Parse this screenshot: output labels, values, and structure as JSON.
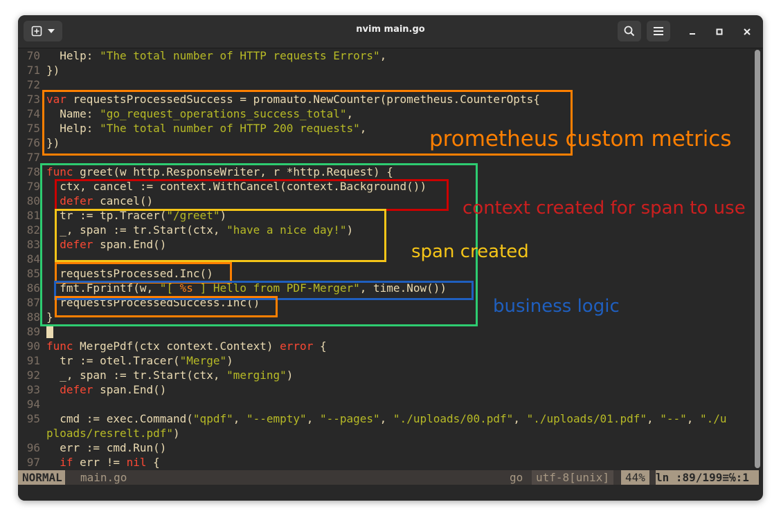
{
  "window": {
    "title": "nvim main.go"
  },
  "titlebar": {
    "new_tab_icon": "new-tab-icon",
    "dropdown_icon": "chevron-down-icon",
    "search_icon": "search-icon",
    "menu_icon": "hamburger-menu-icon",
    "minimize_icon": "minimize-icon",
    "maximize_icon": "maximize-icon",
    "close_icon": "close-icon"
  },
  "code": {
    "lines": [
      {
        "n": "70",
        "segs": [
          [
            "  Help: ",
            ""
          ],
          [
            "\"The total number of HTTP requests Errors\"",
            "str"
          ],
          [
            ",",
            ""
          ]
        ]
      },
      {
        "n": "71",
        "segs": [
          [
            "})",
            ""
          ]
        ]
      },
      {
        "n": "72",
        "segs": []
      },
      {
        "n": "73",
        "segs": [
          [
            "var",
            "kw"
          ],
          [
            " requestsProcessedSuccess = promauto.NewCounter(prometheus.CounterOpts{",
            ""
          ]
        ]
      },
      {
        "n": "74",
        "segs": [
          [
            "  Name: ",
            ""
          ],
          [
            "\"go_request_operations_success_total\"",
            "str"
          ],
          [
            ",",
            ""
          ]
        ]
      },
      {
        "n": "75",
        "segs": [
          [
            "  Help: ",
            ""
          ],
          [
            "\"The total number of HTTP 200 requests\"",
            "str"
          ],
          [
            ",",
            ""
          ]
        ]
      },
      {
        "n": "76",
        "segs": [
          [
            "})",
            ""
          ]
        ]
      },
      {
        "n": "77",
        "segs": []
      },
      {
        "n": "78",
        "segs": [
          [
            "func",
            "kw"
          ],
          [
            " greet(w http.ResponseWriter, r *http.Request) {",
            ""
          ]
        ]
      },
      {
        "n": "79",
        "segs": [
          [
            "  ctx, cancel := context.WithCancel(context.Background())",
            ""
          ]
        ]
      },
      {
        "n": "80",
        "segs": [
          [
            "  ",
            ""
          ],
          [
            "defer",
            "kw"
          ],
          [
            " cancel()",
            ""
          ]
        ]
      },
      {
        "n": "81",
        "segs": [
          [
            "  tr := tp.Tracer(",
            ""
          ],
          [
            "\"/greet\"",
            "str"
          ],
          [
            ")",
            ""
          ]
        ]
      },
      {
        "n": "82",
        "segs": [
          [
            "  _, span := tr.Start(ctx, ",
            ""
          ],
          [
            "\"have a nice day!\"",
            "str"
          ],
          [
            ")",
            ""
          ]
        ]
      },
      {
        "n": "83",
        "segs": [
          [
            "  ",
            ""
          ],
          [
            "defer",
            "kw"
          ],
          [
            " span.End()",
            ""
          ]
        ]
      },
      {
        "n": "84",
        "segs": []
      },
      {
        "n": "85",
        "segs": [
          [
            "  requestsProcessed.Inc()",
            ""
          ]
        ]
      },
      {
        "n": "86",
        "segs": [
          [
            "  fmt.Fprintf(w, ",
            ""
          ],
          [
            "\"[ ",
            "str"
          ],
          [
            "%s",
            "fmt"
          ],
          [
            " ] Hello from PDF-Merger\"",
            "str"
          ],
          [
            ", time.Now())",
            ""
          ]
        ]
      },
      {
        "n": "87",
        "segs": [
          [
            "  requestsProcessedSuccess.Inc()",
            ""
          ]
        ]
      },
      {
        "n": "88",
        "segs": [
          [
            "}",
            ""
          ]
        ]
      },
      {
        "n": "89",
        "segs": [],
        "cursor": true
      },
      {
        "n": "90",
        "segs": [
          [
            "func",
            "kw"
          ],
          [
            " MergePdf(ctx context.Context) ",
            ""
          ],
          [
            "error",
            "kw"
          ],
          [
            " {",
            ""
          ]
        ]
      },
      {
        "n": "91",
        "segs": [
          [
            "  tr := otel.Tracer(",
            ""
          ],
          [
            "\"Merge\"",
            "str"
          ],
          [
            ")",
            ""
          ]
        ]
      },
      {
        "n": "92",
        "segs": [
          [
            "  _, span := tr.Start(ctx, ",
            ""
          ],
          [
            "\"merging\"",
            "str"
          ],
          [
            ")",
            ""
          ]
        ]
      },
      {
        "n": "93",
        "segs": [
          [
            "  ",
            ""
          ],
          [
            "defer",
            "kw"
          ],
          [
            " span.End()",
            ""
          ]
        ]
      },
      {
        "n": "94",
        "segs": []
      },
      {
        "n": "95",
        "segs": [
          [
            "  cmd := exec.Command(",
            ""
          ],
          [
            "\"qpdf\"",
            "str"
          ],
          [
            ", ",
            ""
          ],
          [
            "\"--empty\"",
            "str"
          ],
          [
            ", ",
            ""
          ],
          [
            "\"--pages\"",
            "str"
          ],
          [
            ", ",
            ""
          ],
          [
            "\"./uploads/00.pdf\"",
            "str"
          ],
          [
            ", ",
            ""
          ],
          [
            "\"./uploads/01.pdf\"",
            "str"
          ],
          [
            ", ",
            ""
          ],
          [
            "\"--\"",
            "str"
          ],
          [
            ", ",
            ""
          ],
          [
            "\"./u",
            "str"
          ]
        ]
      },
      {
        "n": "",
        "segs": [
          [
            "ploads/resrelt.pdf\"",
            "str"
          ],
          [
            ")",
            ""
          ]
        ]
      },
      {
        "n": "96",
        "segs": [
          [
            "  err := cmd.Run()",
            ""
          ]
        ]
      },
      {
        "n": "97",
        "segs": [
          [
            "  ",
            ""
          ],
          [
            "if",
            "kw"
          ],
          [
            " err != ",
            ""
          ],
          [
            "nil",
            "kw"
          ],
          [
            " {",
            ""
          ]
        ]
      }
    ]
  },
  "statusline": {
    "mode": "NORMAL",
    "filename": "main.go",
    "filetype": "go",
    "encoding": "utf-8[unix]",
    "percent": "44%",
    "position": "ln :89/199≡℅:1"
  },
  "annotations": {
    "prometheus": "prometheus custom metrics",
    "context": "context created for span to use",
    "span": "span created",
    "business": "business logic"
  },
  "colors": {
    "orange": "#ff7f00",
    "green": "#2ecc71",
    "red": "#cc0000",
    "yellow": "#f5c518",
    "blue": "#1f5fbf"
  }
}
